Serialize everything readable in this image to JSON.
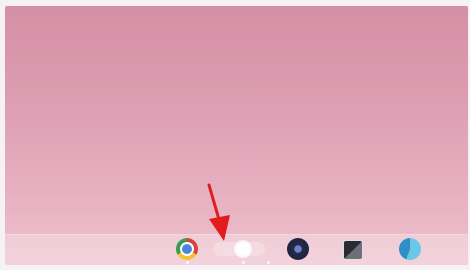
{
  "screen": {
    "wallpaper": {
      "top_color": "#d58fa5",
      "bottom_color": "#edc1cd"
    }
  },
  "shelf": {
    "apps": [
      {
        "icon": "chrome-icon",
        "color": "#d9443a"
      },
      {
        "icon": "app-icon-highlighted",
        "color": "#ffffff"
      },
      {
        "icon": "dark-circle-app-icon",
        "color": "#1c2138"
      },
      {
        "icon": "square-app-icon",
        "color": "#2a2a33"
      },
      {
        "icon": "blue-circle-app-icon",
        "color": "#2e8fc6"
      }
    ]
  },
  "annotation": {
    "arrow_color": "#e11c1c"
  }
}
